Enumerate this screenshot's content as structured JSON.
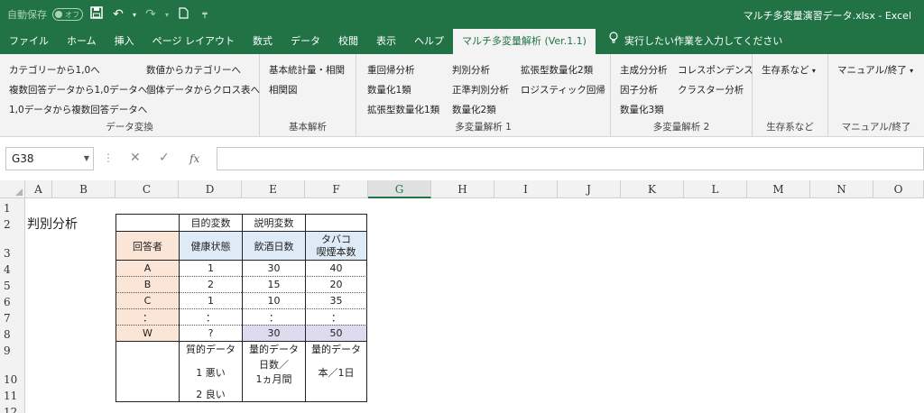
{
  "titlebar": {
    "autosave_label": "自動保存",
    "autosave_state": "オフ",
    "title": "マルチ多変量演習データ.xlsx  -  Excel",
    "accent": "#217346"
  },
  "tabs": [
    {
      "label": "ファイル"
    },
    {
      "label": "ホーム"
    },
    {
      "label": "挿入"
    },
    {
      "label": "ページ レイアウト"
    },
    {
      "label": "数式"
    },
    {
      "label": "データ"
    },
    {
      "label": "校閲"
    },
    {
      "label": "表示"
    },
    {
      "label": "ヘルプ"
    },
    {
      "label": "マルチ多変量解析 (Ver.1.1)"
    }
  ],
  "tellme": "実行したい作業を入力してください",
  "ribbon": {
    "g1": {
      "items": [
        "カテゴリーから1,0へ",
        "数値からカテゴリーへ",
        "複数回答データから1,0データへ",
        "個体データからクロス表へ",
        "1,0データから複数回答データへ"
      ],
      "label": "データ変換"
    },
    "g2": {
      "items": [
        "基本統計量・相関",
        "相関図"
      ],
      "label": "基本解析"
    },
    "g3": {
      "items": [
        "重回帰分析",
        "判別分析",
        "拡張型数量化2類",
        "数量化1類",
        "正準判別分析",
        "ロジスティック回帰",
        "拡張型数量化1類",
        "数量化2類"
      ],
      "label": "多変量解析 1"
    },
    "g4": {
      "items": [
        "主成分分析",
        "コレスポンデンス",
        "因子分析",
        "クラスター分析",
        "数量化3類"
      ],
      "label": "多変量解析 2"
    },
    "g5": {
      "item": "生存系など",
      "label": "生存系など"
    },
    "g6": {
      "item": "マニュアル/終了",
      "label": "マニュアル/終了"
    }
  },
  "formula_bar": {
    "name_box": "G38",
    "fx": "fx",
    "value": ""
  },
  "columns": [
    "A",
    "B",
    "C",
    "D",
    "E",
    "F",
    "G",
    "H",
    "I",
    "J",
    "K",
    "L",
    "M",
    "N",
    "O"
  ],
  "selected_column": "G",
  "rows": [
    "1",
    "2",
    "3",
    "4",
    "5",
    "6",
    "7",
    "8",
    "9",
    "10",
    "11",
    "12"
  ],
  "sheet": {
    "title": "判別分析",
    "hdr_objective": "目的変数",
    "hdr_explanatory": "説明変数",
    "col_respondent": "回答者",
    "col_health": "健康状態",
    "col_drink": "飲酒日数",
    "col_smoke_1": "タバコ",
    "col_smoke_2": "喫煙本数",
    "data_rows": [
      {
        "id": "A",
        "health": "1",
        "drink": "30",
        "smoke": "40"
      },
      {
        "id": "B",
        "health": "2",
        "drink": "15",
        "smoke": "20"
      },
      {
        "id": "C",
        "health": "1",
        "drink": "10",
        "smoke": "35"
      },
      {
        "id": "：",
        "health": "：",
        "drink": "：",
        "smoke": "："
      },
      {
        "id": "W",
        "health": "?",
        "drink": "30",
        "smoke": "50"
      }
    ],
    "type_health": "質的データ",
    "type_health_1": "1  悪い",
    "type_health_2": "2  良い",
    "type_drink": "量的データ",
    "type_drink_unit_1": "日数／",
    "type_drink_unit_2": "1ヵ月間",
    "type_smoke": "量的データ",
    "type_smoke_unit": "本／1日"
  }
}
